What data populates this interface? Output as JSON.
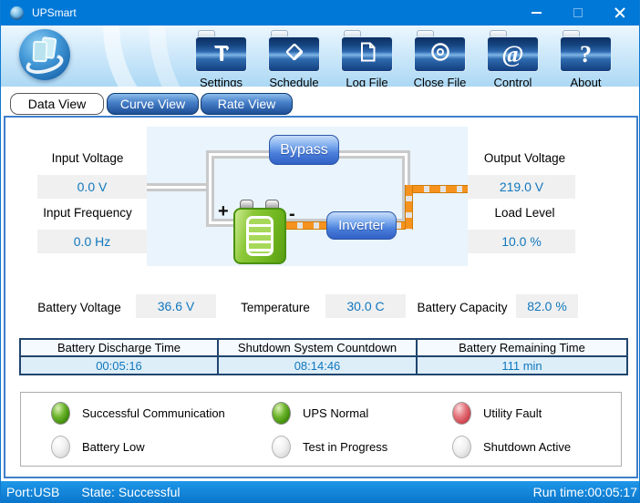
{
  "window": {
    "title": "UPSmart",
    "controls": [
      {
        "name": "minimize-icon"
      },
      {
        "name": "maximize-icon"
      },
      {
        "name": "close-icon"
      }
    ]
  },
  "toolbar": {
    "buttons": [
      {
        "label": "Settings",
        "icon": "hammer-icon"
      },
      {
        "label": "Schedule",
        "icon": "pencil-diamond-icon"
      },
      {
        "label": "Log File",
        "icon": "document-icon"
      },
      {
        "label": "Close File",
        "icon": "disc-icon"
      },
      {
        "label": "Control",
        "icon": "at-sign-icon",
        "glyph": "@"
      },
      {
        "label": "About",
        "icon": "question-mark-icon",
        "glyph": "?"
      }
    ]
  },
  "tabs": [
    {
      "label": "Data View",
      "active": true
    },
    {
      "label": "Curve View",
      "active": false
    },
    {
      "label": "Rate View",
      "active": false
    }
  ],
  "data_view": {
    "input_voltage": {
      "label": "Input Voltage",
      "value": "0.0 V"
    },
    "input_frequency": {
      "label": "Input Frequency",
      "value": "0.0 Hz"
    },
    "output_voltage": {
      "label": "Output Voltage",
      "value": "219.0 V"
    },
    "load_level": {
      "label": "Load Level",
      "value": "10.0 %"
    },
    "diagram": {
      "bypass_label": "Bypass",
      "inverter_label": "Inverter",
      "battery_plus": "+",
      "battery_minus": "-",
      "battery_icon": "battery-icon",
      "flow_color": "#f6921e"
    },
    "battery_voltage": {
      "label": "Battery Voltage",
      "value": "36.6 V"
    },
    "temperature": {
      "label": "Temperature",
      "value": "30.0 C"
    },
    "battery_capacity": {
      "label": "Battery Capacity",
      "value": "82.0 %"
    },
    "timers": {
      "columns": [
        {
          "header": "Battery Discharge Time",
          "value": "00:05:16"
        },
        {
          "header": "Shutdown System Countdown",
          "value": "08:14:46"
        },
        {
          "header": "Battery Remaining Time",
          "value": "111 min"
        }
      ]
    },
    "indicators": [
      {
        "label": "Successful Communication",
        "state": "green"
      },
      {
        "label": "UPS Normal",
        "state": "green"
      },
      {
        "label": "Utility Fault",
        "state": "red"
      },
      {
        "label": "Battery Low",
        "state": "off"
      },
      {
        "label": "Test in Progress",
        "state": "off"
      },
      {
        "label": "Shutdown Active",
        "state": "off"
      }
    ]
  },
  "status_bar": {
    "port": "Port:USB",
    "state": "State: Successful",
    "run_time": "Run time:00:05:17"
  },
  "colors": {
    "titlebar": "#0078d7",
    "value_text": "#1077be",
    "led_green": "#3c8a08",
    "led_red": "#cc3f48",
    "pipe_orange": "#f6921e",
    "panel_border": "#3f80cc"
  }
}
